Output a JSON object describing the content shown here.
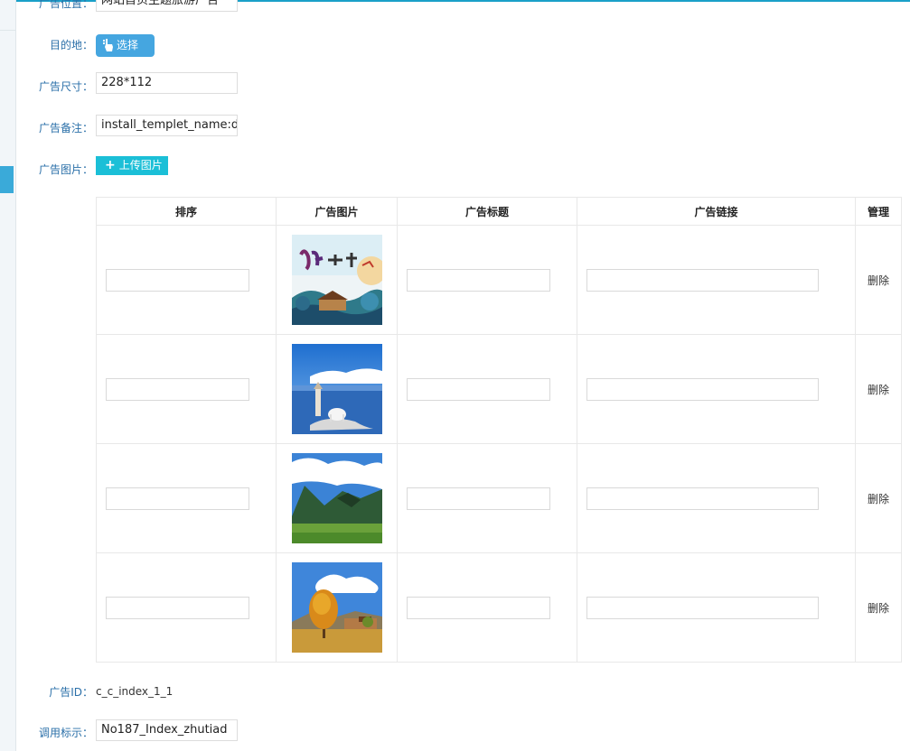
{
  "form": {
    "position": {
      "label": "广告位置：",
      "value": "网站首页主题旅游广告"
    },
    "destination": {
      "label": "目的地：",
      "button": "选择"
    },
    "size": {
      "label": "广告尺寸：",
      "value": "228*112"
    },
    "remark": {
      "label": "广告备注：",
      "value": "install_templet_name:dv"
    },
    "image": {
      "label": "广告图片：",
      "button": "上传图片"
    },
    "ad_id": {
      "label": "广告ID：",
      "value": "c_c_index_1_1"
    },
    "call_tag": {
      "label": "调用标示：",
      "value": "No187_Index_zhutiad"
    }
  },
  "table": {
    "headers": [
      "排序",
      "广告图片",
      "广告标题",
      "广告链接",
      "管理"
    ],
    "rows": [
      {
        "image": "sichuan-banner",
        "action": "删除"
      },
      {
        "image": "lake-shore",
        "action": "删除"
      },
      {
        "image": "green-mountains",
        "action": "删除"
      },
      {
        "image": "autumn-tree",
        "action": "删除"
      }
    ]
  },
  "colors": {
    "accent": "#45a6e0",
    "upload": "#1bbfd7",
    "label": "#2a6fa8",
    "topline": "#1aa0c8"
  },
  "icons": {
    "choose": "pointer-hand-icon",
    "upload": "plus-icon"
  }
}
